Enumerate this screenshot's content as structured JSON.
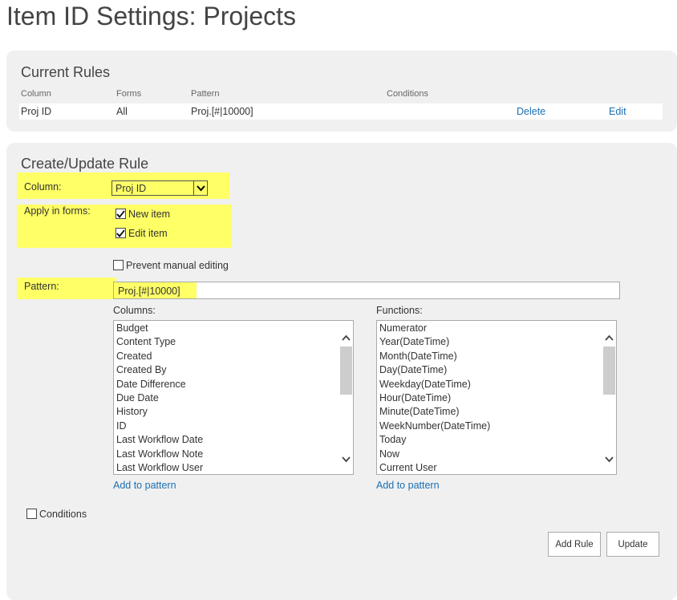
{
  "page": {
    "title": "Item ID Settings: Projects"
  },
  "current_rules": {
    "title": "Current Rules",
    "headers": {
      "column": "Column",
      "forms": "Forms",
      "pattern": "Pattern",
      "conditions": "Conditions"
    },
    "rows": [
      {
        "column": "Proj ID",
        "forms": "All",
        "pattern": "Proj.[#|10000]",
        "conditions": "",
        "delete": "Delete",
        "edit": "Edit"
      }
    ]
  },
  "create_rule": {
    "title": "Create/Update Rule",
    "column_label": "Column:",
    "column_value": "Proj ID",
    "forms_label": "Apply in forms:",
    "new_item_label": "New item",
    "new_item_checked": true,
    "edit_item_label": "Edit item",
    "edit_item_checked": true,
    "prevent_label": "Prevent manual editing",
    "prevent_checked": false,
    "pattern_label": "Pattern:",
    "pattern_value": "Proj.[#|10000]",
    "columns_label": "Columns:",
    "columns": [
      "Budget",
      "Content Type",
      "Created",
      "Created By",
      "Date Difference",
      "Due Date",
      "History",
      "ID",
      "Last Workflow Date",
      "Last Workflow Note",
      "Last Workflow User"
    ],
    "functions_label": "Functions:",
    "functions": [
      "Numerator",
      "Year(DateTime)",
      "Month(DateTime)",
      "Day(DateTime)",
      "Weekday(DateTime)",
      "Hour(DateTime)",
      "Minute(DateTime)",
      "WeekNumber(DateTime)",
      "Today",
      "Now",
      "Current User"
    ],
    "add_to_pattern": "Add to pattern",
    "conditions_label": "Conditions",
    "conditions_checked": false,
    "add_rule_button": "Add Rule",
    "update_button": "Update"
  },
  "colors": {
    "highlight": "#ffff66",
    "link": "#1a6fb3",
    "panel": "#f0f0f0"
  },
  "icons": {
    "dropdown": "chevron-down-icon",
    "check": "checkmark-icon",
    "scroll_up": "chevron-up-icon",
    "scroll_down": "chevron-down-icon"
  }
}
